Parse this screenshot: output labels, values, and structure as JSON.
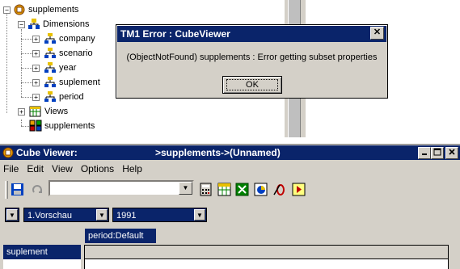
{
  "tree": {
    "root": "supplements",
    "dimensions_label": "Dimensions",
    "dimensions": [
      "company",
      "scenario",
      "year",
      "suplement",
      "period"
    ],
    "views_label": "Views",
    "view_item": "supplements"
  },
  "dialog": {
    "title": "TM1 Error : CubeViewer",
    "close_glyph": "✕",
    "message": "(ObjectNotFound) supplements : Error getting subset properties",
    "ok_label": "OK"
  },
  "cube_viewer": {
    "title": "Cube Viewer:",
    "subtitle": ">supplements->(Unnamed)",
    "menu": [
      "File",
      "Edit",
      "View",
      "Options",
      "Help"
    ],
    "view_combo_value": "",
    "title_selectors": [
      "1.Vorschau",
      "1991"
    ],
    "column_header": "period:Default",
    "row_header": "suplement",
    "window_buttons": [
      "minimize",
      "maximize",
      "close"
    ]
  },
  "colors": {
    "title_bar": "#0a246a",
    "face": "#d4d0c8"
  }
}
